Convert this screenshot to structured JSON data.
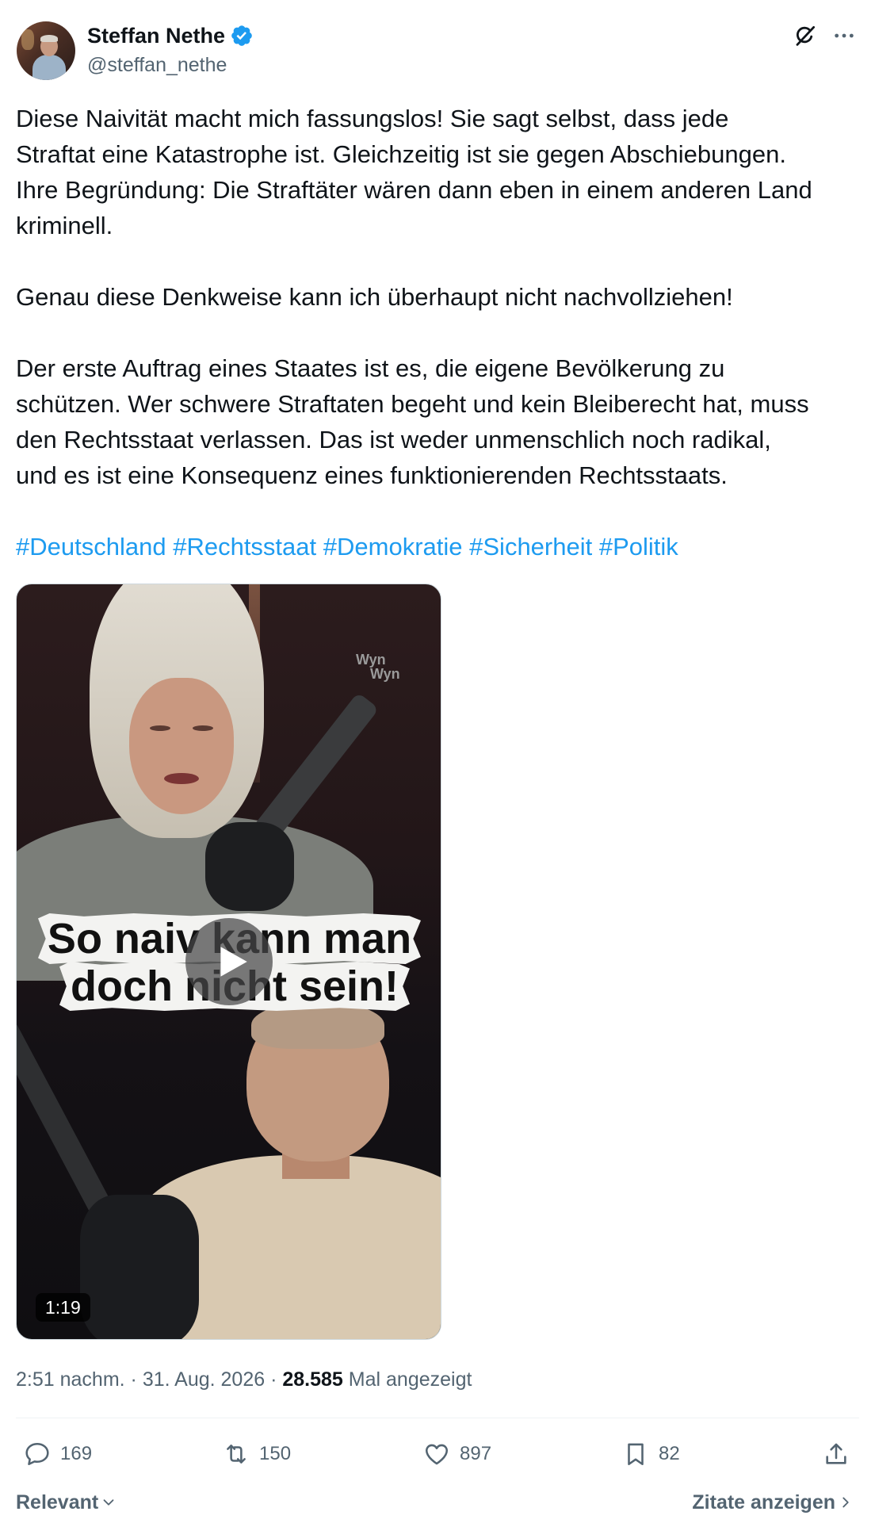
{
  "author": {
    "name": "Steffan Nethe",
    "handle": "@steffan_nethe",
    "verified": true
  },
  "tweet": {
    "paragraphs": [
      {
        "lines": [
          "Diese Naivität macht mich fassungslos! Sie sagt selbst, dass jede",
          "Straftat eine Katastrophe ist. Gleichzeitig ist sie gegen Abschiebungen.",
          "Ihre Begründung: Die Straftäter wären dann eben in einem anderen Land",
          "kriminell."
        ]
      },
      {
        "lines": [
          "Genau diese Denkweise kann ich überhaupt nicht nachvollziehen!"
        ]
      },
      {
        "lines": [
          "Der erste Auftrag eines Staates ist es, die eigene Bevölkerung zu",
          "schützen. Wer schwere Straftaten begeht und kein Bleiberecht hat, muss",
          "den Rechtsstaat verlassen. Das ist weder unmenschlich noch radikal,",
          "und es ist eine Konsequenz eines funktionierenden Rechtsstaats."
        ]
      }
    ],
    "hashtags": [
      "#Deutschland",
      "#Rechtsstaat",
      "#Demokratie",
      "#Sicherheit",
      "#Politik"
    ]
  },
  "media": {
    "caption_lines": [
      "So naiv kann man",
      "doch nicht sein!"
    ],
    "watermark_lines": [
      "Wyn",
      "Wyn"
    ],
    "duration": "1:19"
  },
  "meta": {
    "time": "2:51 nachm.",
    "separator": "·",
    "date": "31. Aug. 2026",
    "views": "28.585",
    "views_label": "Mal angezeigt"
  },
  "actions": {
    "replies": "169",
    "reposts": "150",
    "likes": "897",
    "bookmarks": "82"
  },
  "footer": {
    "sort_label": "Relevant",
    "quotes_link": "Zitate anzeigen"
  },
  "icons": {
    "verified": "verified-badge-icon",
    "grok": "grok-icon",
    "more": "more-icon",
    "play": "play-icon",
    "reply": "reply-icon",
    "repost": "repost-icon",
    "like": "heart-icon",
    "bookmark": "bookmark-icon",
    "share": "share-icon",
    "sort_chevron": "chevron-down-icon",
    "quotes_chevron": "chevron-right-icon"
  },
  "colors": {
    "text": "#0f1419",
    "secondary": "#536471",
    "link": "#1d9bf0",
    "verified": "#1d9bf0",
    "divider": "#eff3f4",
    "background": "#ffffff"
  }
}
